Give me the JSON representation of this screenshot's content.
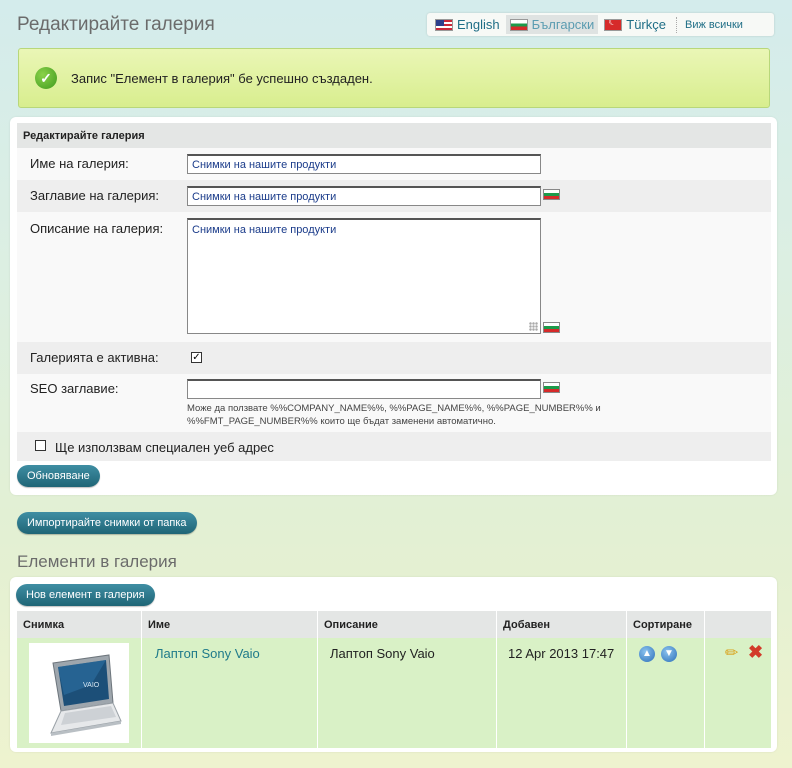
{
  "header": {
    "title": "Редактирайте галерия",
    "languages": [
      {
        "label": "English",
        "icon": "flag-us-icon"
      },
      {
        "label": "Български",
        "icon": "flag-bg-icon",
        "active": true
      },
      {
        "label": "Türkçe",
        "icon": "flag-tr-icon"
      }
    ],
    "view_all": "Виж всички"
  },
  "success_message": "Запис \"Елемент в галерия\" бе успешно създаден.",
  "form": {
    "heading": "Редактирайте галерия",
    "gallery_name_label": "Име на галерия:",
    "gallery_name_value": "Снимки на нашите продукти",
    "gallery_title_label": "Заглавие на галерия:",
    "gallery_title_value": "Снимки на нашите продукти",
    "gallery_desc_label": "Описание на галерия:",
    "gallery_desc_value": "Снимки на нашите продукти",
    "active_label": "Галерията е активна:",
    "active_checked": true,
    "seo_label": "SEO заглавие:",
    "seo_value": "",
    "seo_hint": "Може да ползвате %%COMPANY_NAME%%, %%PAGE_NAME%%, %%PAGE_NUMBER%% и %%FMT_PAGE_NUMBER%% които ще бъдат заменени автоматично.",
    "special_url_label": "Ще използвам специален уеб адрес",
    "update_button": "Обновяване"
  },
  "import_button": "Импортирайте снимки от папка",
  "items_section": {
    "title": "Елементи в галерия",
    "new_button": "Нов елемент в галерия",
    "columns": [
      "Снимка",
      "Име",
      "Описание",
      "Добавен",
      "Сортиране"
    ],
    "rows": [
      {
        "name": "Лаптоп Sony Vaio",
        "description": "Лаптоп Sony Vaio",
        "added": "12 Apr 2013 17:47"
      }
    ]
  },
  "colors": {
    "accent": "#1f6576",
    "success_bg": "#d8ee8e",
    "row_highlight": "#d9f1c6"
  }
}
